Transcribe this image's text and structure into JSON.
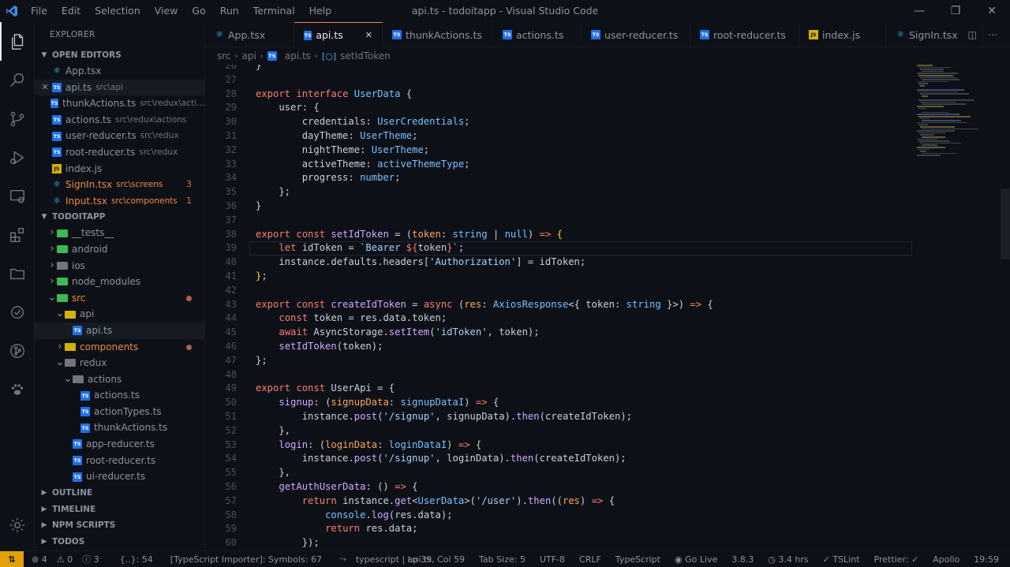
{
  "titlebar": {
    "menu": [
      "File",
      "Edit",
      "Selection",
      "View",
      "Go",
      "Run",
      "Terminal",
      "Help"
    ],
    "window_title": "api.ts - todoitapp - Visual Studio Code"
  },
  "activity_bar": [
    "files-icon",
    "search-icon",
    "source-control-icon",
    "run-debug-icon",
    "remote-explorer-icon",
    "extensions-icon",
    "folder-icon",
    "testing-icon",
    "git-graph-icon",
    "paw-icon",
    "settings-gear-icon"
  ],
  "sidebar": {
    "title": "EXPLORER",
    "open_editors_label": "OPEN EDITORS",
    "open_editors": [
      {
        "name": "App.tsx",
        "hint": "",
        "icon": "react"
      },
      {
        "name": "api.ts",
        "hint": "src\\api",
        "icon": "ts",
        "active": true
      },
      {
        "name": "thunkActions.ts",
        "hint": "src\\redux\\acti...",
        "icon": "ts"
      },
      {
        "name": "actions.ts",
        "hint": "src\\redux\\actions",
        "icon": "ts"
      },
      {
        "name": "user-reducer.ts",
        "hint": "src\\redux",
        "icon": "ts"
      },
      {
        "name": "root-reducer.ts",
        "hint": "src\\redux",
        "icon": "ts"
      },
      {
        "name": "index.js",
        "hint": "",
        "icon": "js"
      },
      {
        "name": "SignIn.tsx",
        "hint": "src\\screens",
        "icon": "react",
        "error": true,
        "count": "3"
      },
      {
        "name": "Input.tsx",
        "hint": "src\\components",
        "icon": "react",
        "error": true,
        "count": "1"
      }
    ],
    "project_label": "TODOITAPP",
    "tree": [
      {
        "name": "__tests__",
        "depth": 1,
        "type": "folder",
        "color": "green",
        "open": false
      },
      {
        "name": "android",
        "depth": 1,
        "type": "folder",
        "color": "green",
        "open": false
      },
      {
        "name": "ios",
        "depth": 1,
        "type": "folder",
        "color": "grey",
        "open": false
      },
      {
        "name": "node_modules",
        "depth": 1,
        "type": "folder",
        "color": "green",
        "open": false
      },
      {
        "name": "src",
        "depth": 1,
        "type": "folder",
        "color": "green",
        "open": true,
        "dot": true,
        "error": true
      },
      {
        "name": "api",
        "depth": 2,
        "type": "folder",
        "color": "yellow",
        "open": true
      },
      {
        "name": "api.ts",
        "depth": 3,
        "type": "ts",
        "selected": true
      },
      {
        "name": "components",
        "depth": 2,
        "type": "folder",
        "color": "yellow",
        "open": false,
        "dot": true,
        "error": true
      },
      {
        "name": "redux",
        "depth": 2,
        "type": "folder",
        "color": "grey",
        "open": true
      },
      {
        "name": "actions",
        "depth": 3,
        "type": "folder",
        "color": "grey",
        "open": true
      },
      {
        "name": "actions.ts",
        "depth": 4,
        "type": "ts"
      },
      {
        "name": "actionTypes.ts",
        "depth": 4,
        "type": "ts"
      },
      {
        "name": "thunkActions.ts",
        "depth": 4,
        "type": "ts"
      },
      {
        "name": "app-reducer.ts",
        "depth": 3,
        "type": "ts"
      },
      {
        "name": "root-reducer.ts",
        "depth": 3,
        "type": "ts"
      },
      {
        "name": "ui-reducer.ts",
        "depth": 3,
        "type": "ts"
      }
    ],
    "bottom_sections": [
      "OUTLINE",
      "TIMELINE",
      "NPM SCRIPTS",
      "TODOS"
    ]
  },
  "tabs": [
    {
      "label": "App.tsx",
      "icon": "react"
    },
    {
      "label": "api.ts",
      "icon": "ts",
      "active": true
    },
    {
      "label": "thunkActions.ts",
      "icon": "ts"
    },
    {
      "label": "actions.ts",
      "icon": "ts"
    },
    {
      "label": "user-reducer.ts",
      "icon": "ts"
    },
    {
      "label": "root-reducer.ts",
      "icon": "ts"
    },
    {
      "label": "index.js",
      "icon": "js"
    },
    {
      "label": "SignIn.tsx",
      "icon": "react"
    }
  ],
  "breadcrumb": [
    "src",
    "api",
    "api.ts",
    "setIdToken"
  ],
  "editor": {
    "first_line": 26,
    "current_line": 39,
    "lines": [
      [
        [
          "g",
          "}"
        ]
      ],
      [],
      [
        [
          "k",
          "export "
        ],
        [
          "k",
          "interface "
        ],
        [
          "t",
          "UserData"
        ],
        [
          "g",
          " {"
        ]
      ],
      [
        [
          "g",
          "    user: {"
        ]
      ],
      [
        [
          "g",
          "        credentials: "
        ],
        [
          "t",
          "UserCredentials"
        ],
        [
          "g",
          ";"
        ]
      ],
      [
        [
          "g",
          "        dayTheme: "
        ],
        [
          "t",
          "UserTheme"
        ],
        [
          "g",
          ";"
        ]
      ],
      [
        [
          "g",
          "        nightTheme: "
        ],
        [
          "t",
          "UserTheme"
        ],
        [
          "g",
          ";"
        ]
      ],
      [
        [
          "g",
          "        activeTheme: "
        ],
        [
          "t",
          "activeThemeType"
        ],
        [
          "g",
          ";"
        ]
      ],
      [
        [
          "g",
          "        progress: "
        ],
        [
          "t",
          "number"
        ],
        [
          "g",
          ";"
        ]
      ],
      [
        [
          "g",
          "    };"
        ]
      ],
      [
        [
          "g",
          "}"
        ]
      ],
      [],
      [
        [
          "k",
          "export "
        ],
        [
          "k",
          "const "
        ],
        [
          "f",
          "setIdToken"
        ],
        [
          "g",
          " = ("
        ],
        [
          "p",
          "token"
        ],
        [
          "g",
          ": "
        ],
        [
          "t",
          "string"
        ],
        [
          "g",
          " | "
        ],
        [
          "t",
          "null"
        ],
        [
          "g",
          ") "
        ],
        [
          "k",
          "=>"
        ],
        [
          "y",
          " {"
        ]
      ],
      [
        [
          "g",
          "    "
        ],
        [
          "k",
          "let "
        ],
        [
          "g",
          "idToken = "
        ],
        [
          "s",
          "`Bearer "
        ],
        [
          "k",
          "${"
        ],
        [
          "g",
          "token"
        ],
        [
          "k",
          "}"
        ],
        [
          "s",
          "`"
        ],
        [
          "g",
          ";"
        ]
      ],
      [
        [
          "g",
          "    instance.defaults.headers["
        ],
        [
          "s",
          "'Authorization'"
        ],
        [
          "g",
          "] = idToken;"
        ]
      ],
      [
        [
          "y",
          "}"
        ],
        [
          "g",
          ";"
        ]
      ],
      [],
      [
        [
          "k",
          "export "
        ],
        [
          "k",
          "const "
        ],
        [
          "f",
          "createIdToken"
        ],
        [
          "g",
          " = "
        ],
        [
          "k",
          "async "
        ],
        [
          "g",
          "("
        ],
        [
          "p",
          "res"
        ],
        [
          "g",
          ": "
        ],
        [
          "t",
          "AxiosResponse"
        ],
        [
          "g",
          "<{ token: "
        ],
        [
          "t",
          "string"
        ],
        [
          "g",
          " }>) "
        ],
        [
          "k",
          "=>"
        ],
        [
          "g",
          " {"
        ]
      ],
      [
        [
          "g",
          "    "
        ],
        [
          "k",
          "const "
        ],
        [
          "g",
          "token = res.data.token;"
        ]
      ],
      [
        [
          "g",
          "    "
        ],
        [
          "k",
          "await "
        ],
        [
          "g",
          "AsyncStorage."
        ],
        [
          "f",
          "setItem"
        ],
        [
          "g",
          "("
        ],
        [
          "s",
          "'idToken'"
        ],
        [
          "g",
          ", token);"
        ]
      ],
      [
        [
          "g",
          "    "
        ],
        [
          "f",
          "setIdToken"
        ],
        [
          "g",
          "(token);"
        ]
      ],
      [
        [
          "g",
          "};"
        ]
      ],
      [],
      [
        [
          "k",
          "export "
        ],
        [
          "k",
          "const "
        ],
        [
          "g",
          "UserApi = {"
        ]
      ],
      [
        [
          "g",
          "    "
        ],
        [
          "f",
          "signup"
        ],
        [
          "g",
          ": ("
        ],
        [
          "p",
          "signupData"
        ],
        [
          "g",
          ": "
        ],
        [
          "t",
          "signupDataI"
        ],
        [
          "g",
          ") "
        ],
        [
          "k",
          "=>"
        ],
        [
          "g",
          " {"
        ]
      ],
      [
        [
          "g",
          "        instance."
        ],
        [
          "f",
          "post"
        ],
        [
          "g",
          "("
        ],
        [
          "s",
          "'/signup'"
        ],
        [
          "g",
          ", signupData)."
        ],
        [
          "f",
          "then"
        ],
        [
          "g",
          "(createIdToken);"
        ]
      ],
      [
        [
          "g",
          "    },"
        ]
      ],
      [
        [
          "g",
          "    "
        ],
        [
          "f",
          "login"
        ],
        [
          "g",
          ": ("
        ],
        [
          "p",
          "loginData"
        ],
        [
          "g",
          ": "
        ],
        [
          "t",
          "loginDataI"
        ],
        [
          "g",
          ") "
        ],
        [
          "k",
          "=>"
        ],
        [
          "g",
          " {"
        ]
      ],
      [
        [
          "g",
          "        instance."
        ],
        [
          "f",
          "post"
        ],
        [
          "g",
          "("
        ],
        [
          "s",
          "'/signup'"
        ],
        [
          "g",
          ", loginData)."
        ],
        [
          "f",
          "then"
        ],
        [
          "g",
          "(createIdToken);"
        ]
      ],
      [
        [
          "g",
          "    },"
        ]
      ],
      [
        [
          "g",
          "    "
        ],
        [
          "f",
          "getAuthUserData"
        ],
        [
          "g",
          ": () "
        ],
        [
          "k",
          "=>"
        ],
        [
          "g",
          " {"
        ]
      ],
      [
        [
          "g",
          "        "
        ],
        [
          "k",
          "return "
        ],
        [
          "g",
          "instance."
        ],
        [
          "f",
          "get"
        ],
        [
          "g",
          "<"
        ],
        [
          "t",
          "UserData"
        ],
        [
          "g",
          ">("
        ],
        [
          "s",
          "'/user'"
        ],
        [
          "g",
          ")."
        ],
        [
          "f",
          "then"
        ],
        [
          "g",
          "(("
        ],
        [
          "p",
          "res"
        ],
        [
          "g",
          ") "
        ],
        [
          "k",
          "=>"
        ],
        [
          "g",
          " {"
        ]
      ],
      [
        [
          "g",
          "            "
        ],
        [
          "t",
          "console"
        ],
        [
          "g",
          "."
        ],
        [
          "f",
          "log"
        ],
        [
          "g",
          "(res.data);"
        ]
      ],
      [
        [
          "g",
          "            "
        ],
        [
          "k",
          "return "
        ],
        [
          "g",
          "res.data;"
        ]
      ],
      [
        [
          "g",
          "        });"
        ]
      ]
    ]
  },
  "statusbar": {
    "left": [
      "⊗ 4",
      "⚠ 0",
      "ⓘ 3",
      "{..}: 54",
      "[TypeScript Importer]: Symbols: 67",
      "typescript | api.ts"
    ],
    "right": [
      "Ln 39, Col 59",
      "Tab Size: 5",
      "UTF-8",
      "CRLF",
      "TypeScript",
      "Go Live",
      "3.8.3",
      "3.4 hrs",
      "TSLint",
      "Prettier: ✓",
      "Apollo",
      "19:59"
    ]
  },
  "colors": {
    "accent_tab": "#f78166",
    "remote": "#e3a008",
    "error": "#f0883e"
  }
}
